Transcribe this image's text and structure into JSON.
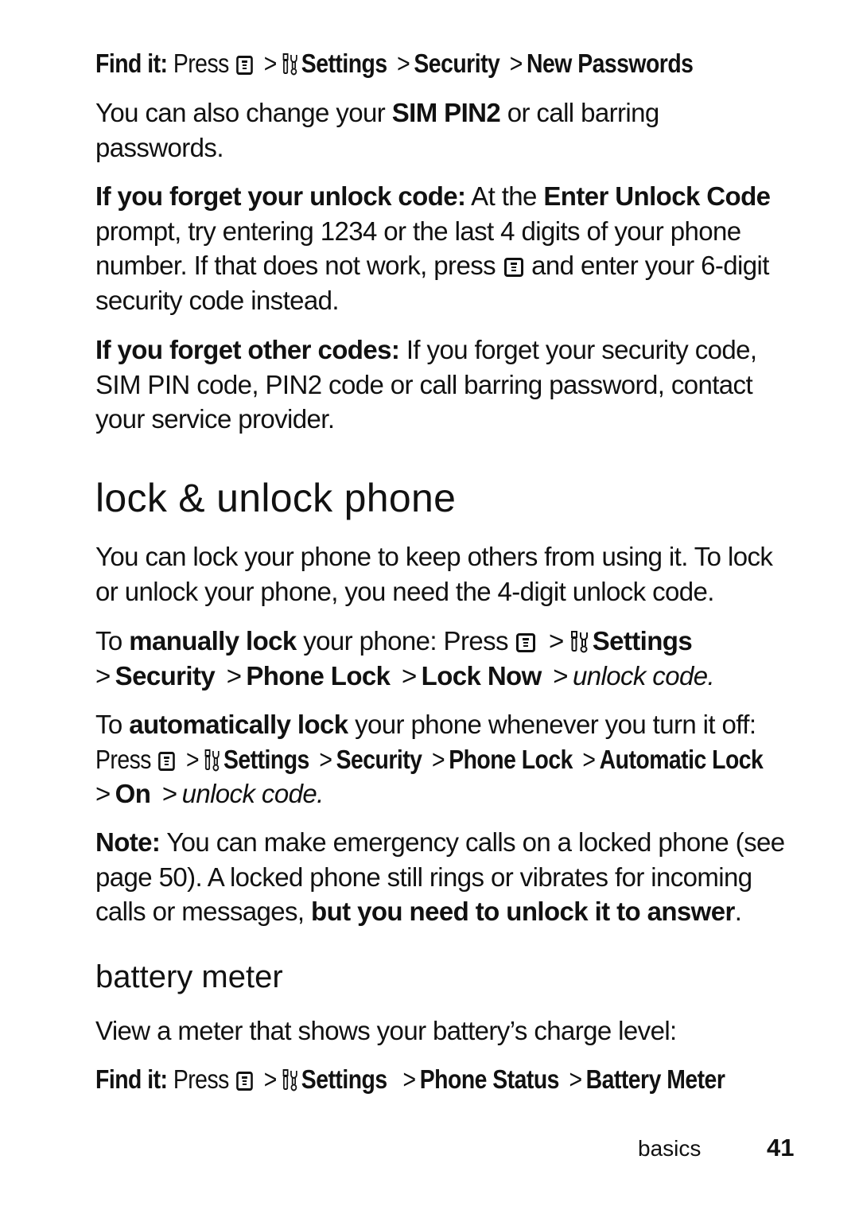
{
  "sections": {
    "find_it_passwords": {
      "lead": "Find it:",
      "press": "Press",
      "path": [
        "Settings",
        "Security",
        "New Passwords"
      ]
    },
    "sim_pin2": {
      "pre": "You can also change your ",
      "bold": "SIM PIN2",
      "post": " or call barring passwords."
    },
    "forget_unlock": {
      "lead": "If you forget your unlock code:",
      "text1": " At the ",
      "prompt": "Enter Unlock Code",
      "text2": " prompt, try entering 1234 or the last 4 digits of your phone number. If that does not work, press ",
      "text3": " and enter your 6-digit security code instead."
    },
    "forget_other": {
      "lead": "If you forget other codes:",
      "text": " If you forget your security code, SIM PIN code, PIN2 code or call barring password, contact your service provider."
    },
    "lock_heading": "lock & unlock phone",
    "lock_intro": "You can lock your phone to keep others from using it. To lock or unlock your phone, you need the 4-digit unlock code.",
    "manual_lock": {
      "pre": "To ",
      "bold": "manually lock",
      "post": " your phone: Press",
      "path": [
        "Settings",
        "Security",
        "Phone Lock",
        "Lock Now"
      ],
      "end": "unlock code."
    },
    "auto_lock": {
      "pre": "To ",
      "bold": "automatically lock",
      "post": " your phone whenever you turn it off:",
      "press": "Press",
      "path": [
        "Settings",
        "Security",
        "Phone Lock",
        "Automatic Lock",
        "On"
      ],
      "end": "unlock code."
    },
    "note": {
      "lead": "Note:",
      "text": " You can make emergency calls on a locked phone (see page 50). A locked phone still rings or vibrates for incoming calls or messages, ",
      "bold": "but you need to unlock it to answer",
      "end": "."
    },
    "battery_heading": "battery meter",
    "battery_intro": "View a meter that shows your battery’s charge level:",
    "find_it_battery": {
      "lead": "Find it:",
      "press": "Press",
      "path": [
        "Settings",
        "Phone Status",
        "Battery Meter"
      ]
    }
  },
  "footer": {
    "section": "basics",
    "page": "41"
  },
  "icons": {
    "menu_key": "menu-key-icon",
    "settings": "settings-tools-icon",
    "separator": ">"
  }
}
